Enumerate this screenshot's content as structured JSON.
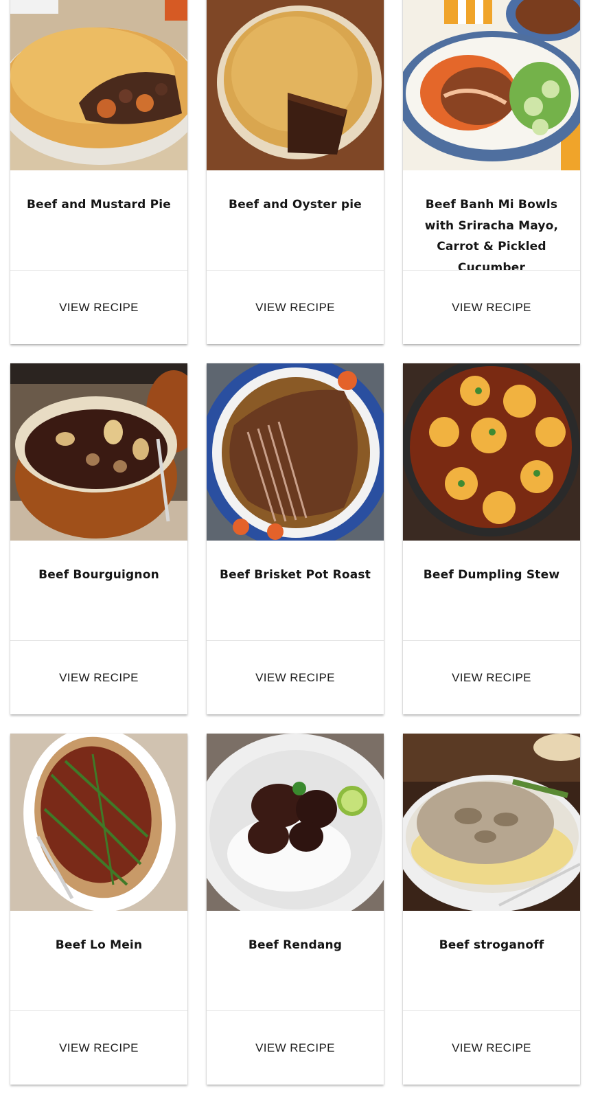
{
  "recipes": [
    {
      "title": "Beef and Mustard Pie",
      "button": "VIEW RECIPE",
      "image": "pie-crust-photo"
    },
    {
      "title": "Beef and Oyster pie",
      "button": "VIEW RECIPE",
      "image": "pie-slice-photo"
    },
    {
      "title": "Beef Banh Mi Bowls with Sriracha Mayo, Carrot & Pickled Cucumber",
      "button": "VIEW RECIPE",
      "image": "rice-bowl-photo"
    },
    {
      "title": "Beef Bourguignon",
      "button": "VIEW RECIPE",
      "image": "stew-pot-photo"
    },
    {
      "title": "Beef Brisket Pot Roast",
      "button": "VIEW RECIPE",
      "image": "brisket-platter-photo"
    },
    {
      "title": "Beef Dumpling Stew",
      "button": "VIEW RECIPE",
      "image": "dumpling-pan-photo"
    },
    {
      "title": "Beef Lo Mein",
      "button": "VIEW RECIPE",
      "image": "noodle-platter-photo"
    },
    {
      "title": "Beef Rendang",
      "button": "VIEW RECIPE",
      "image": "rendang-plate-photo"
    },
    {
      "title": "Beef stroganoff",
      "button": "VIEW RECIPE",
      "image": "stroganoff-plate-photo"
    }
  ]
}
